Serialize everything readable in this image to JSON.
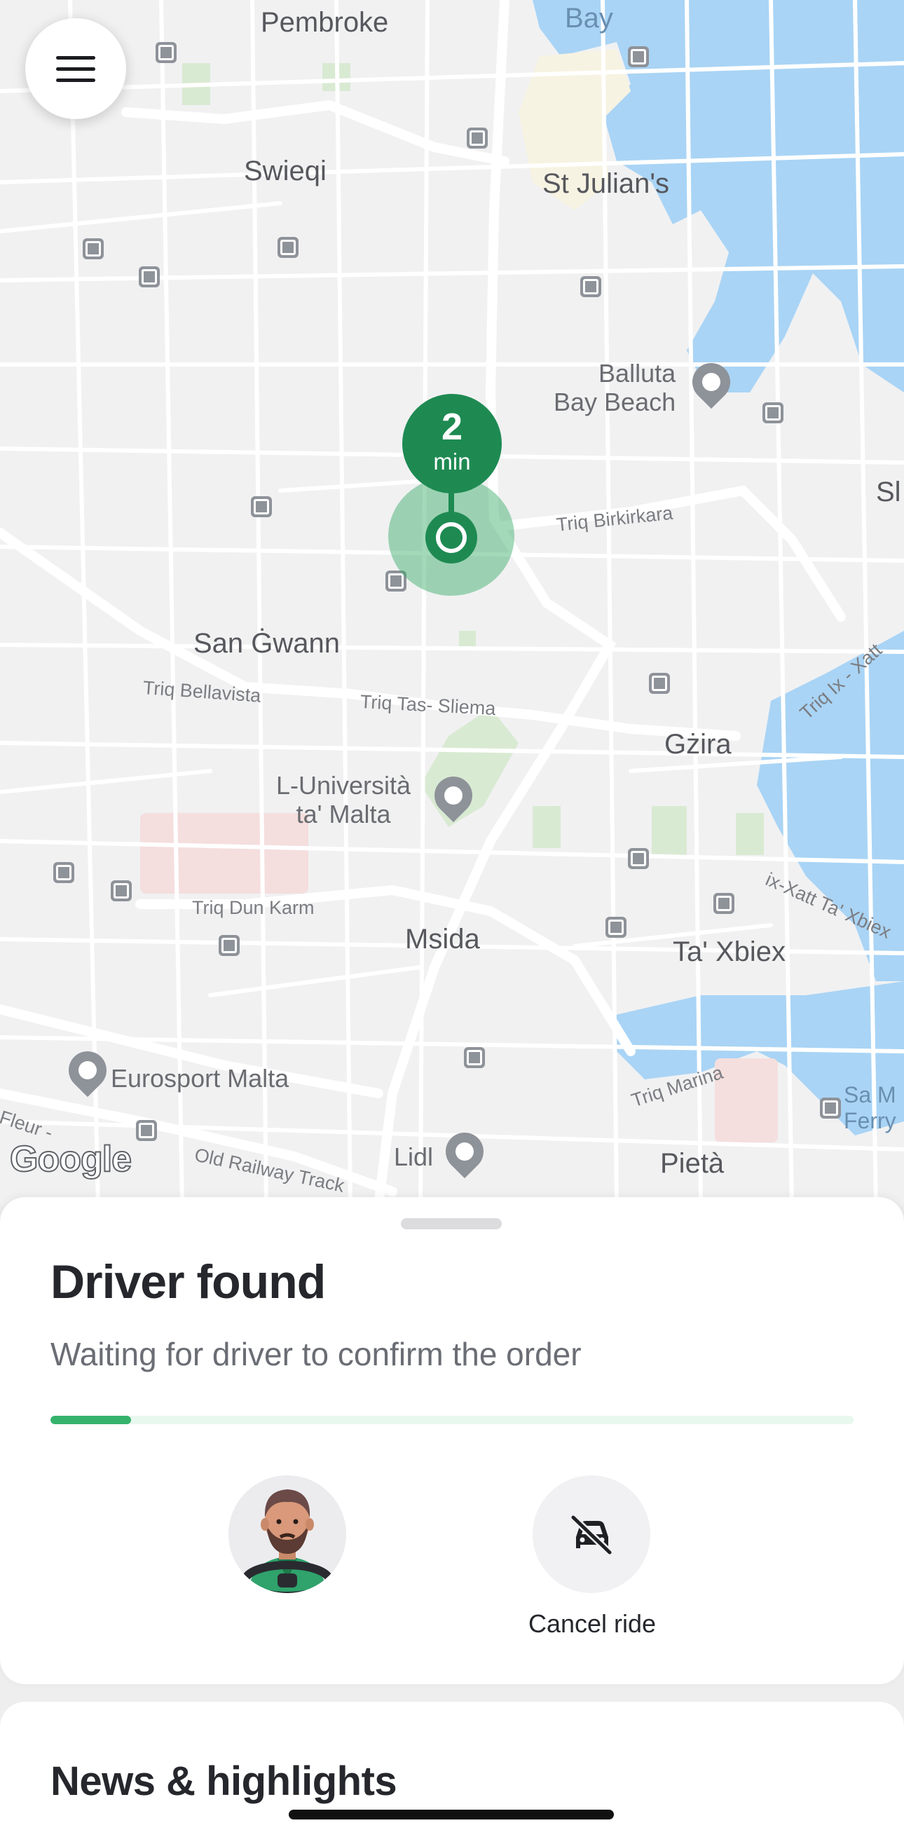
{
  "map": {
    "places": {
      "pembroke": "Pembroke",
      "bay": "Bay",
      "swieqi": "Swieqi",
      "st_julians": "St Julian's",
      "balluta": "Balluta\nBay Beach",
      "san_gwann": "San Ġwann",
      "gzira": "Gżira",
      "universita": "L-Università\nta' Malta",
      "msida": "Msida",
      "ta_xbiex": "Ta' Xbiex",
      "eurosport": "Eurosport Malta",
      "lidl": "Lidl",
      "pieta": "Pietà",
      "sa_m": "Sa M\nFerry",
      "sl": "Sl"
    },
    "streets": {
      "birkirkara": "Triq Birkirkara",
      "bellavista": "Triq Bellavista",
      "tas_sliema": "Triq Tas- Sliema",
      "dun_karm": "Triq Dun Karm",
      "ix_xatt": "Triq Ix - Xatt",
      "ix_xatt_xbiex": "ix-Xatt Ta' Xbiex",
      "marina": "Triq Marina",
      "old_railway": "Old Railway Track",
      "fleur": "Fleur -"
    },
    "eta_value": "2",
    "eta_unit": "min",
    "attribution": "Google"
  },
  "sheet": {
    "title": "Driver found",
    "subtitle": "Waiting for driver to confirm the order",
    "progress_fraction": 0.1,
    "cancel_label": "Cancel ride"
  },
  "news": {
    "title": "News & highlights"
  },
  "colors": {
    "accent": "#1e8a52",
    "progress": "#35b36c",
    "water": "#a9d4f5"
  },
  "icons": {
    "menu": "hamburger-menu-icon",
    "cancel": "car-off-icon",
    "location": "location-pin-icon"
  }
}
